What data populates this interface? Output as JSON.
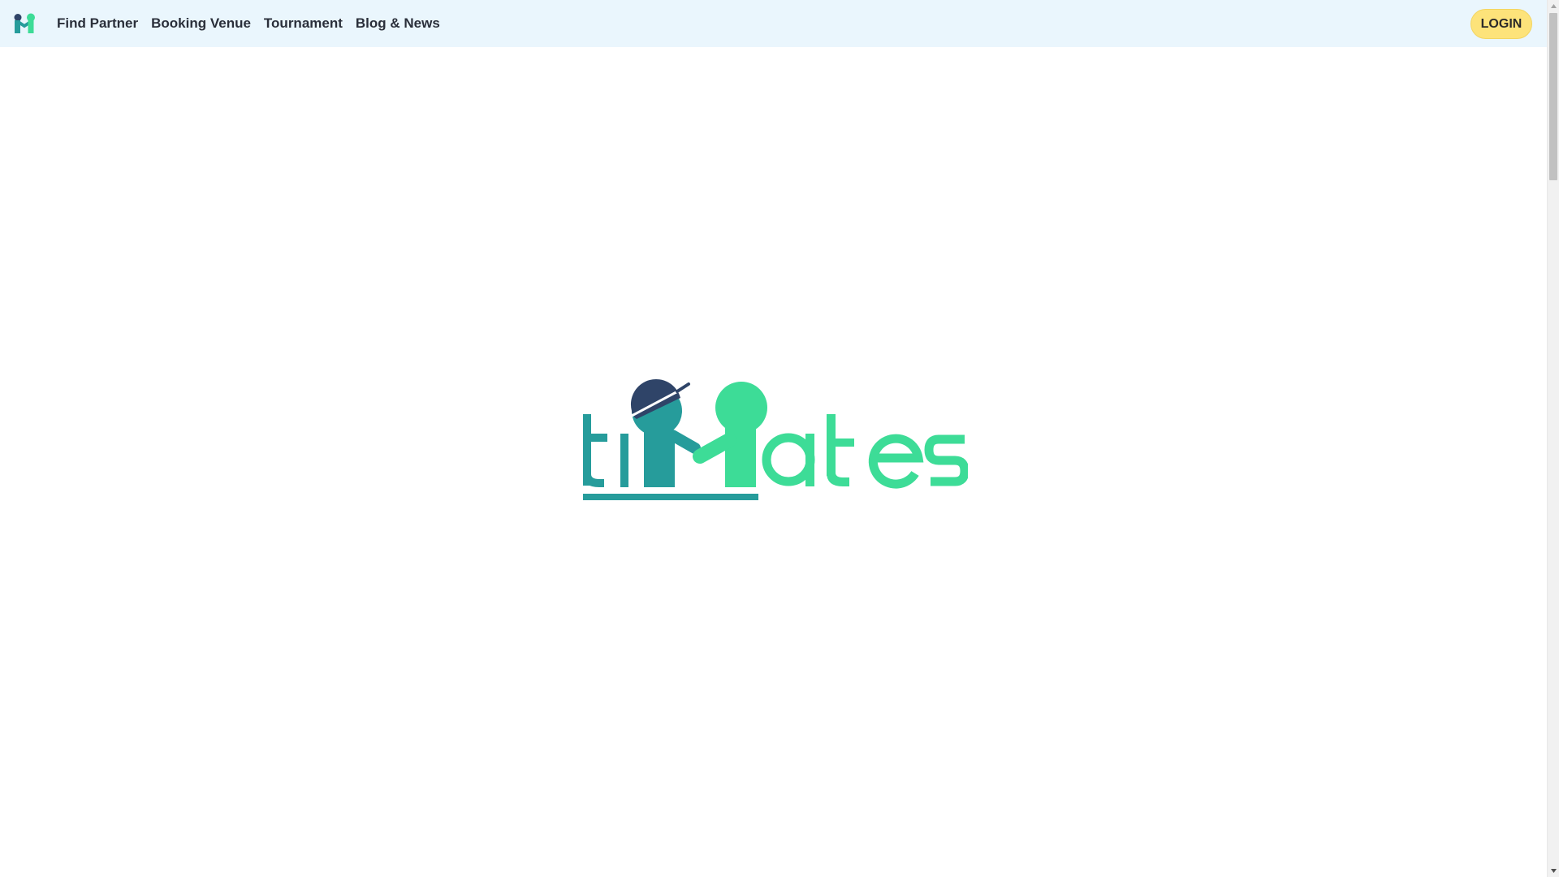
{
  "nav": {
    "logo_icon": "timates-mini-logo-icon",
    "links": [
      {
        "label": "Find Partner"
      },
      {
        "label": "Booking Venue"
      },
      {
        "label": "Tournament"
      },
      {
        "label": "Blog & News"
      }
    ],
    "login_label": "LOGIN"
  },
  "splash": {
    "logo_icon": "timates-logo",
    "logo_text": "tiMates"
  },
  "colors": {
    "nav_background": "#eaf6fd",
    "login_background": "#fde37a",
    "teal": "#269c9b",
    "green": "#3ddc97",
    "navy": "#2f4468",
    "text": "#2a2f3a"
  }
}
